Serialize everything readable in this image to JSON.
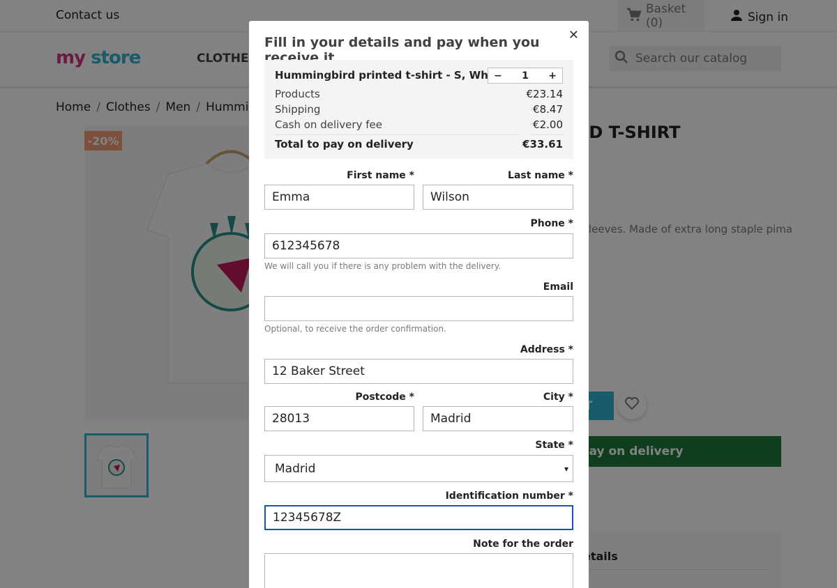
{
  "header": {
    "contact": "Contact us",
    "basket": "Basket (0)",
    "signin": "Sign in",
    "logo_my": "my",
    "logo_store": "store",
    "nav_clothes": "CLOTHES",
    "search_placeholder": "Search our catalog"
  },
  "page": {
    "breadcrumb": [
      "Home",
      "Clothes",
      "Men",
      "Hummingbi"
    ],
    "discount": "-20%",
    "title_fragment": "ED T-SHIRT",
    "desc_fragment": "leeves. Made of extra long staple pima",
    "add_fragment": "ET",
    "cod_fragment": ", pay on delivery",
    "details_fragment": "etails"
  },
  "modal": {
    "title": "Fill in your details and pay when you receive it",
    "product": "Hummingbird printed t-shirt - S, White",
    "qty": {
      "minus": "−",
      "value": "1",
      "plus": "+"
    },
    "rows": [
      {
        "label": "Products",
        "value": "€23.14"
      },
      {
        "label": "Shipping",
        "value": "€8.47"
      },
      {
        "label": "Cash on delivery fee",
        "value": "€2.00"
      }
    ],
    "total": {
      "label": "Total to pay on delivery",
      "value": "€33.61"
    },
    "fields": {
      "first_name": {
        "label": "First name *",
        "value": "Emma"
      },
      "last_name": {
        "label": "Last name *",
        "value": "Wilson"
      },
      "phone": {
        "label": "Phone *",
        "value": "612345678",
        "hint": "We will call you if there is any problem with the delivery."
      },
      "email": {
        "label": "Email",
        "value": "",
        "hint": "Optional, to receive the order confirmation."
      },
      "address": {
        "label": "Address *",
        "value": "12 Baker Street"
      },
      "postcode": {
        "label": "Postcode *",
        "value": "28013"
      },
      "city": {
        "label": "City *",
        "value": "Madrid"
      },
      "state": {
        "label": "State *",
        "value": "Madrid"
      },
      "id_number": {
        "label": "Identification number *",
        "value": "12345678Z"
      },
      "note": {
        "label": "Note for the order",
        "value": ""
      }
    }
  },
  "colors": {
    "accent": "#2fb5d2",
    "cod_green": "#1f7a3e",
    "discount": "#f39d72",
    "focus_border": "#1a56a7"
  }
}
